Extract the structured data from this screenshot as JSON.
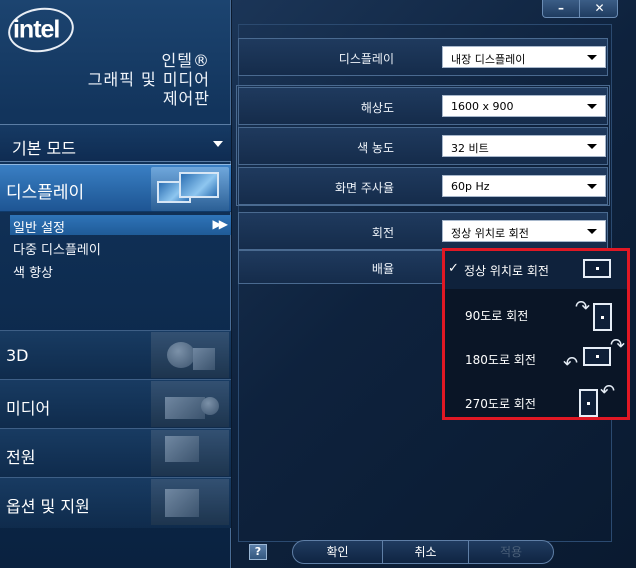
{
  "brand": {
    "logo_text": "intel",
    "line1": "인텔®",
    "line2": "그래픽 및 미디어",
    "line3": "제어판"
  },
  "window": {
    "min_label": "–",
    "close_label": "✕"
  },
  "sidebar": {
    "mode_label": "기본 모드",
    "display_category": "디스플레이",
    "subitems": [
      {
        "label": "일반 설정",
        "selected": true,
        "marker": "▶▶"
      },
      {
        "label": "다중 디스플레이"
      },
      {
        "label": "색 향상"
      }
    ],
    "categories": [
      {
        "label": "3D"
      },
      {
        "label": "미디어"
      },
      {
        "label": "전원"
      },
      {
        "label": "옵션 및 지원"
      }
    ]
  },
  "settings": {
    "display": {
      "label": "디스플레이",
      "value": "내장 디스플레이"
    },
    "resolution": {
      "label": "해상도",
      "value": "1600 x 900"
    },
    "color_depth": {
      "label": "색 농도",
      "value": "32 비트"
    },
    "refresh_rate": {
      "label": "화면 주사율",
      "value": "60p Hz"
    },
    "rotation": {
      "label": "회전",
      "value": "정상 위치로 회전"
    },
    "scaling": {
      "label": "배율"
    }
  },
  "rotation_menu": {
    "check": "✓",
    "options": [
      {
        "label": "정상 위치로 회전",
        "selected": true
      },
      {
        "label": "90도로 회전"
      },
      {
        "label": "180도로 회전"
      },
      {
        "label": "270도로 회전"
      }
    ]
  },
  "footer": {
    "help_label": "?",
    "ok_label": "확인",
    "cancel_label": "취소",
    "apply_label": "적용"
  },
  "colors": {
    "accent": "#2b6aab",
    "highlight_border": "#e01824",
    "background": "#0b1a2e"
  }
}
